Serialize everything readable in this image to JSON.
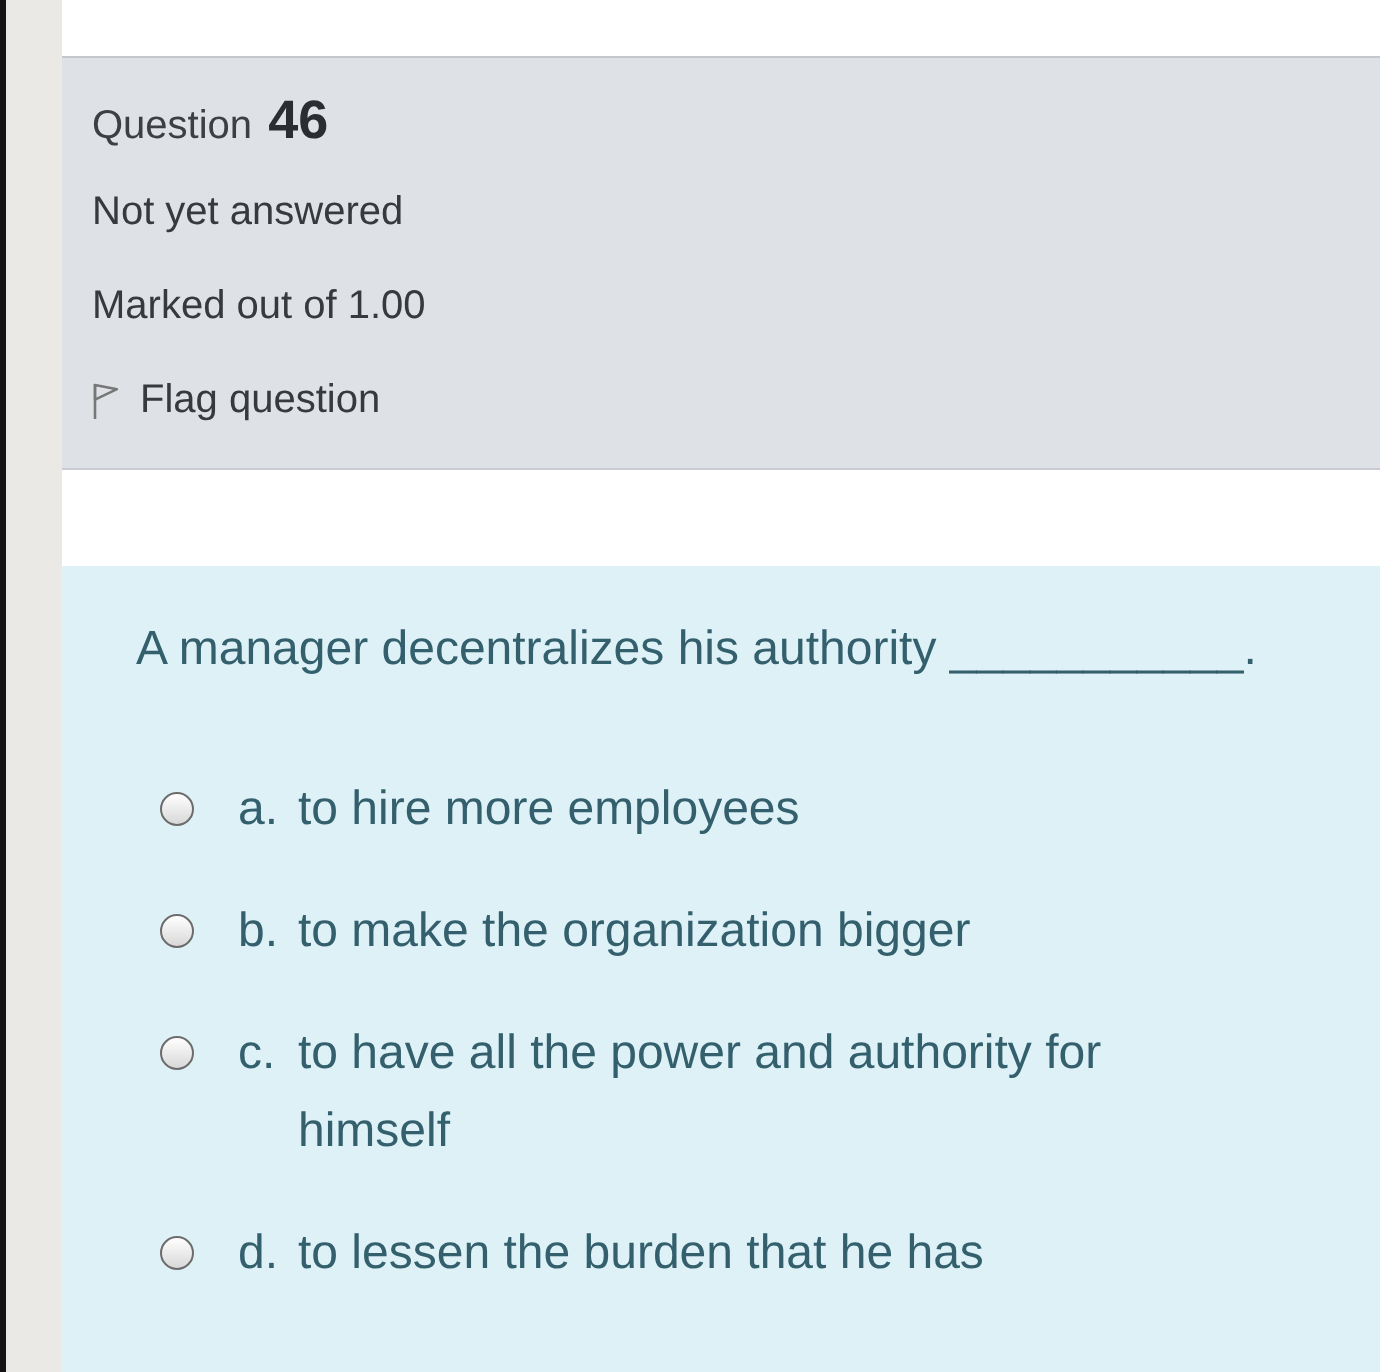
{
  "question_info": {
    "label": "Question",
    "number": "46",
    "state": "Not yet answered",
    "grade": "Marked out of 1.00",
    "flag": {
      "label": "Flag question",
      "flagged": false
    }
  },
  "formulation": {
    "text": "A manager decentralizes his authority ___________.",
    "options": [
      {
        "letter": "a.",
        "text": "to hire more employees",
        "selected": false
      },
      {
        "letter": "b.",
        "text": "to make the organization bigger",
        "selected": false
      },
      {
        "letter": "c.",
        "text": "to have all the power and authority for himself",
        "selected": false
      },
      {
        "letter": "d.",
        "text": "to lessen the burden that he has",
        "selected": false
      }
    ]
  }
}
